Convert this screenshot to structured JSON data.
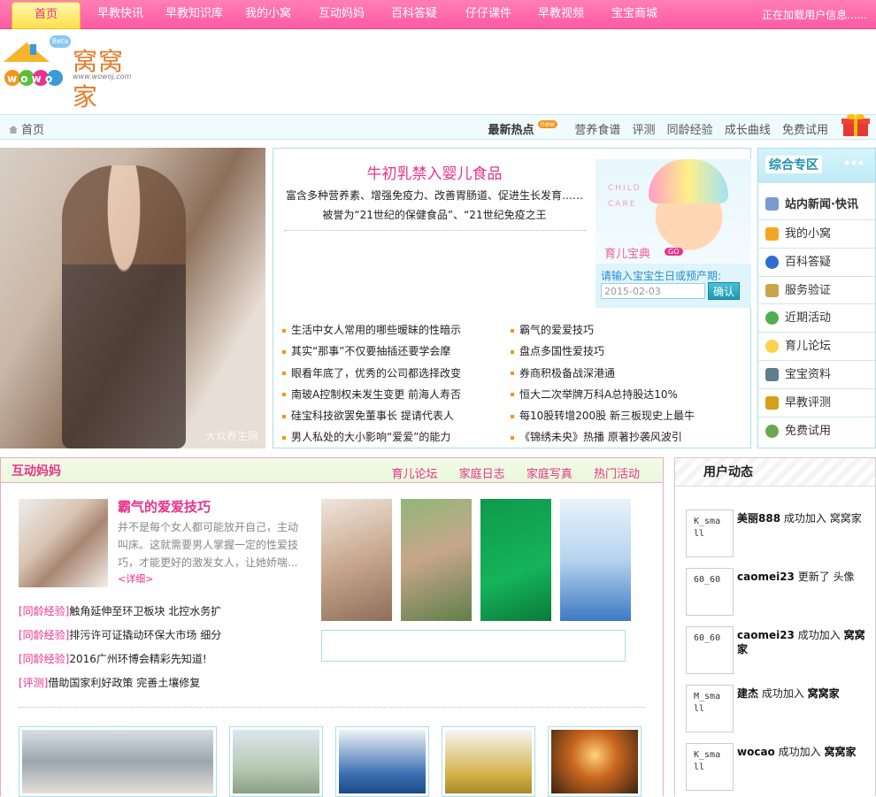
{
  "topnav": {
    "items": [
      "首页",
      "早教快讯",
      "早教知识库",
      "我的小窝",
      "互动妈妈",
      "百科答疑",
      "仔仔课件",
      "早教视频",
      "宝宝商城"
    ],
    "status": "正在加载用户信息......"
  },
  "logo": {
    "beta": "Beta",
    "wordmark": "窝窝家",
    "url": "www.wowoj.com"
  },
  "breadcrumb": {
    "home": "首页"
  },
  "hot": {
    "title": "最新热点",
    "badge": "new",
    "links": [
      "营养食谱",
      "评测",
      "同龄经验",
      "成长曲线",
      "免费试用"
    ]
  },
  "banner": {
    "watermark": "大众养生网"
  },
  "promo": {
    "title": "牛初乳禁入婴儿食品",
    "desc1": "富含多种营养素、增强免疫力、改善胃肠道、促进生长发育……",
    "desc2": "被誉为“21世纪的保健食品”、“21世纪免疫之王",
    "baby_care": "CHILD\nCARE",
    "baby_label": "育儿宝典",
    "baby_go": "GO",
    "birth_label": "请输入宝宝生日或预产期:",
    "birth_value": "2015-02-03",
    "birth_button": "确认",
    "news_left": [
      "生活中女人常用的哪些暧昧的性暗示",
      "其实“那事”不仅要抽插还要学会摩",
      "眼看年底了，优秀的公司都选择改变",
      "南玻A控制权未发生变更 前海人寿否",
      "硅宝科技欲罢免董事长 提请代表人",
      "男人私处的大小影响“爱爱”的能力"
    ],
    "news_right": [
      "霸气的爱爱技巧",
      "盘点多国性爱技巧",
      "券商积极备战深港通",
      "恒大二次举牌万科A总持股达10%",
      "每10股转增200股 新三板现史上最牛",
      "《锦绣未央》热播 原著抄袭风波引"
    ]
  },
  "side": {
    "title": "综合专区",
    "items": [
      "站内新闻·快讯",
      "我的小窝",
      "百科答疑",
      "服务验证",
      "近期活动",
      "育儿论坛",
      "宝宝资料",
      "早教评测",
      "免费试用"
    ]
  },
  "mama": {
    "title": "互动妈妈",
    "tabs": [
      "育儿论坛",
      "家庭日志",
      "家庭写真",
      "热门活动"
    ],
    "feature_title": "霸气的爱爱技巧",
    "feature_text": "并不是每个女人都可能放开自己，主动叫床。这就需要男人掌握一定的性爱技巧，才能更好的激发女人，让她娇喘...",
    "feature_more": "<详细>",
    "exp": [
      {
        "tag": "[同龄经验]",
        "text": "触角延伸至环卫板块 北控水务扩"
      },
      {
        "tag": "[同龄经验]",
        "text": "排污许可证撬动环保大市场 细分"
      },
      {
        "tag": "[同龄经验]",
        "text": "2016广州环博会精彩先知道!"
      },
      {
        "tag": "[评测]",
        "text": "借助国家利好政策 完善土壤修复"
      }
    ]
  },
  "user_dynamics": {
    "title": "用户动态",
    "rows": [
      {
        "avatar": "K_small",
        "user": "美丽888",
        "action": " 成功加入 ",
        "target": "窝窝家"
      },
      {
        "avatar": "60_60",
        "user": "caomei23",
        "action": " 更新了 头像",
        "target": ""
      },
      {
        "avatar": "60_60",
        "user": "caomei23",
        "action": " 成功加入 ",
        "target": "窝窝家"
      },
      {
        "avatar": "M_small",
        "user": "建杰",
        "action": " 成功加入 ",
        "target": "窝窝家"
      },
      {
        "avatar": "K_small",
        "user": "wocao",
        "action": " 成功加入 ",
        "target": "窝窝家"
      }
    ]
  }
}
